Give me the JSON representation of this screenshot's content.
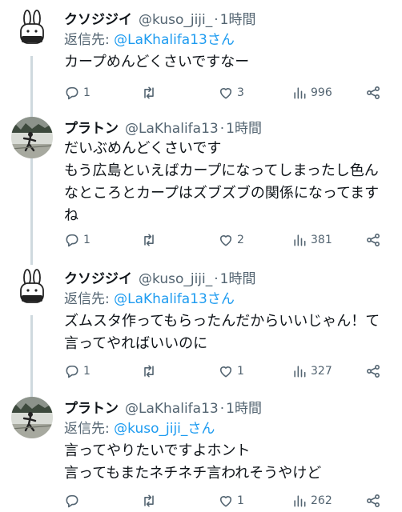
{
  "tweets": [
    {
      "name": "クソジジイ",
      "handle": "@kuso_jiji_",
      "dot": "·",
      "time": "1時間",
      "reply_prefix": "返信先:",
      "reply_target": "@LaKhalifa13さん",
      "text": "カープめんどくさいですなー",
      "avatar": "rabbit-avatar-icon",
      "replies": "1",
      "retweets": "",
      "likes": "3",
      "views": "996"
    },
    {
      "name": "プラトン",
      "handle": "@LaKhalifa13",
      "dot": "·",
      "time": "1時間",
      "reply_prefix": "",
      "reply_target": "",
      "text": "だいぶめんどくさいです\nもう広島といえばカープになってしまったし色んなところとカープはズブズブの関係になってますね",
      "avatar": "photo-avatar-icon",
      "replies": "1",
      "retweets": "",
      "likes": "2",
      "views": "381"
    },
    {
      "name": "クソジジイ",
      "handle": "@kuso_jiji_",
      "dot": "·",
      "time": "1時間",
      "reply_prefix": "返信先:",
      "reply_target": "@LaKhalifa13さん",
      "text": "ズムスタ作ってもらったんだからいいじゃん！て言ってやればいいのに",
      "avatar": "rabbit-avatar-icon",
      "replies": "1",
      "retweets": "",
      "likes": "1",
      "views": "327"
    },
    {
      "name": "プラトン",
      "handle": "@LaKhalifa13",
      "dot": "·",
      "time": "1時間",
      "reply_prefix": "返信先:",
      "reply_target": "@kuso_jiji_さん",
      "text": "言ってやりたいですよホント\n言ってもまたネチネチ言われそうやけど",
      "avatar": "photo-avatar-icon",
      "replies": "",
      "retweets": "",
      "likes": "1",
      "views": "262"
    }
  ],
  "colors": {
    "text": "#0f1419",
    "secondary": "#536471",
    "link": "#1d9bf0",
    "thread_line": "#cfd9de"
  }
}
